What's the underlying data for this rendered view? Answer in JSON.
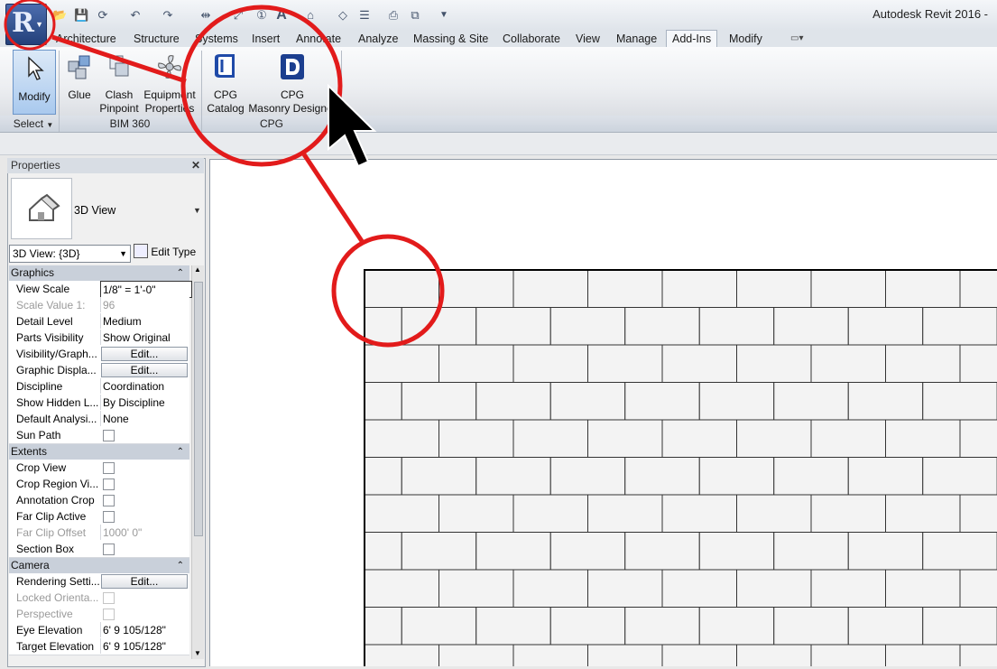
{
  "app": {
    "title": "Autodesk Revit 2016 -",
    "app_button_letter": "R"
  },
  "qat": {
    "icons": [
      "open-icon",
      "save-icon",
      "sync-icon",
      "undo-icon",
      "redo-icon",
      "measure-icon",
      "dimension-icon",
      "tag-icon",
      "text-icon",
      "3d-view-icon",
      "section-icon",
      "thin-lines-icon",
      "close-windows-icon",
      "switch-windows-icon",
      "customize-qat-icon"
    ]
  },
  "tabs": [
    "Architecture",
    "Structure",
    "Systems",
    "Insert",
    "Annotate",
    "Analyze",
    "Massing & Site",
    "Collaborate",
    "View",
    "Manage",
    "Add-Ins",
    "Modify"
  ],
  "active_tab": "Add-Ins",
  "ribbon": {
    "modify_label": "Modify",
    "select_label": "Select",
    "bim360": {
      "panel_label": "BIM 360",
      "glue_label": "Glue",
      "clash_label_1": "Clash",
      "clash_label_2": "Pinpoint",
      "equip_label_1": "Equipment",
      "equip_label_2": "Properties"
    },
    "cpg": {
      "panel_label": "CPG",
      "catalog_label_1": "CPG",
      "catalog_label_2": "Catalog",
      "designer_label_1": "CPG",
      "designer_label_2": "Masonry Designer"
    }
  },
  "properties": {
    "title": "Properties",
    "type_name": "3D View",
    "view_selector": "3D View: {3D}",
    "edit_type": "Edit Type",
    "groups": {
      "graphics": "Graphics",
      "extents": "Extents",
      "camera": "Camera"
    },
    "rows": {
      "view_scale": [
        "View Scale",
        "1/8\" = 1'-0\""
      ],
      "scale_value": [
        "Scale Value    1:",
        "96"
      ],
      "detail_level": [
        "Detail Level",
        "Medium"
      ],
      "parts_visibility": [
        "Parts Visibility",
        "Show Original"
      ],
      "visibility_graph": [
        "Visibility/Graph...",
        "Edit..."
      ],
      "graphic_display": [
        "Graphic Displa...",
        "Edit..."
      ],
      "discipline": [
        "Discipline",
        "Coordination"
      ],
      "show_hidden": [
        "Show Hidden L...",
        "By Discipline"
      ],
      "default_analysis": [
        "Default Analysi...",
        "None"
      ],
      "sun_path": [
        "Sun Path",
        ""
      ],
      "crop_view": [
        "Crop View",
        ""
      ],
      "crop_region": [
        "Crop Region Vi...",
        ""
      ],
      "annotation_crop": [
        "Annotation Crop",
        ""
      ],
      "far_clip_active": [
        "Far Clip Active",
        ""
      ],
      "far_clip_offset": [
        "Far Clip Offset",
        "1000'  0\""
      ],
      "section_box": [
        "Section Box",
        ""
      ],
      "rendering": [
        "Rendering Setti...",
        "Edit..."
      ],
      "locked_orient": [
        "Locked Orienta...",
        ""
      ],
      "perspective": [
        "Perspective",
        ""
      ],
      "eye_elevation": [
        "Eye Elevation",
        "6'  9 105/128\""
      ],
      "target_elevation": [
        "Target Elevation",
        "6'  9 105/128\""
      ]
    }
  },
  "colors": {
    "annotation_red": "#e21b1b",
    "active_tab_bg": "#f5f7fa",
    "selected_button": "#a9c9ee"
  }
}
